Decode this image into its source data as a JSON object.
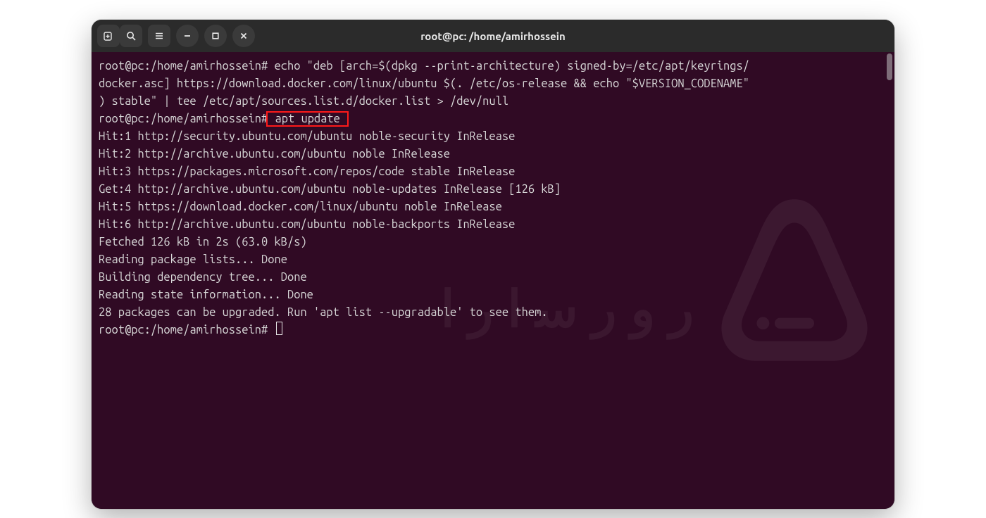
{
  "window": {
    "title": "root@pc: /home/amirhossein"
  },
  "icons": {
    "newtab": "new-tab-icon",
    "search": "search-icon",
    "menu": "menu-icon",
    "minimize": "minimize-icon",
    "maximize": "maximize-icon",
    "close": "close-icon"
  },
  "prompt": "root@pc:/home/amirhossein#",
  "highlight_cmd": " apt update ",
  "lines": [
    "root@pc:/home/amirhossein# echo \"deb [arch=$(dpkg --print-architecture) signed-by=/etc/apt/keyrings/",
    "docker.asc] https://download.docker.com/linux/ubuntu $(. /etc/os-release && echo \"$VERSION_CODENAME\"",
    ") stable\" | tee /etc/apt/sources.list.d/docker.list > /dev/null",
    "Hit:1 http://security.ubuntu.com/ubuntu noble-security InRelease",
    "Hit:2 http://archive.ubuntu.com/ubuntu noble InRelease",
    "Hit:3 https://packages.microsoft.com/repos/code stable InRelease",
    "Get:4 http://archive.ubuntu.com/ubuntu noble-updates InRelease [126 kB]",
    "Hit:5 https://download.docker.com/linux/ubuntu noble InRelease",
    "Hit:6 http://archive.ubuntu.com/ubuntu noble-backports InRelease",
    "Fetched 126 kB in 2s (63.0 kB/s)",
    "Reading package lists... Done",
    "Building dependency tree... Done",
    "Reading state information... Done",
    "28 packages can be upgraded. Run 'apt list --upgradable' to see them."
  ]
}
